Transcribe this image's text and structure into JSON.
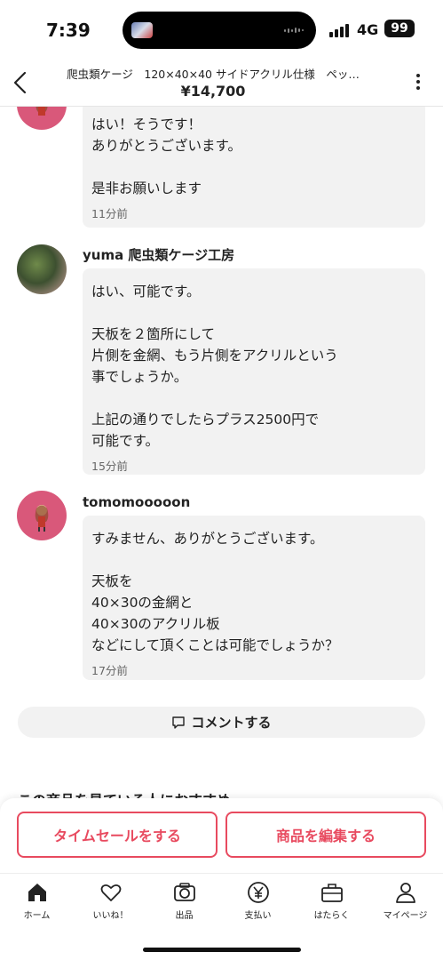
{
  "status_bar": {
    "time": "7:39",
    "network": "4G",
    "battery": "99"
  },
  "header": {
    "title": "爬虫類ケージ　120×40×40 サイドアクリル仕様　ペッ…",
    "price": "¥14,700"
  },
  "comments": [
    {
      "author": "",
      "text": "はい！そうです！\nありがとうございます。\n\n是非お願いします",
      "time": "11分前"
    },
    {
      "author": "yuma 爬虫類ケージ工房",
      "text": "はい、可能です。\n\n天板を２箇所にして\n片側を金網、もう片側をアクリルという\n事でしょうか。\n\n上記の通りでしたらプラス2500円で\n可能です。",
      "time": "15分前"
    },
    {
      "author": "tomomooooon",
      "text": "すみません、ありがとうございます。\n\n天板を\n40×30の金網と\n40×30のアクリル板\nなどにして頂くことは可能でしょうか？",
      "time": "17分前"
    }
  ],
  "comment_button": {
    "label": "コメントする"
  },
  "recommend_title": "この商品を見ている人におすすめ",
  "actions": {
    "time_sale": "タイムセールをする",
    "edit_item": "商品を編集する"
  },
  "tabs": [
    {
      "label": "ホーム",
      "icon": "home-icon"
    },
    {
      "label": "いいね！",
      "icon": "heart-icon"
    },
    {
      "label": "出品",
      "icon": "camera-icon"
    },
    {
      "label": "支払い",
      "icon": "yen-icon"
    },
    {
      "label": "はたらく",
      "icon": "briefcase-icon"
    },
    {
      "label": "マイページ",
      "icon": "person-icon"
    }
  ],
  "colors": {
    "accent": "#e84a5f",
    "bubble": "#f2f2f2",
    "avatar_pink": "#d9587a"
  }
}
